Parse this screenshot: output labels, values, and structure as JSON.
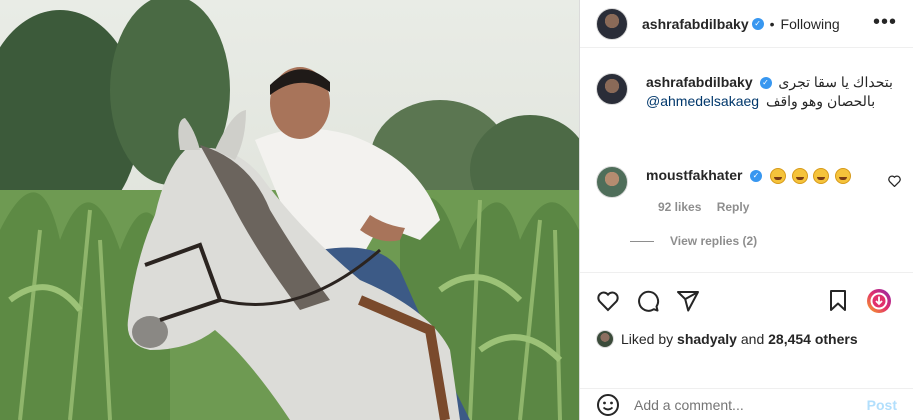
{
  "post": {
    "username": "ashrafabdilbaky",
    "follow_status": "Following",
    "separator": "•",
    "caption_line1": "بتحداك يا سقا تجرى",
    "caption_mention": "@ahmedelsakaeg",
    "caption_line2": "بالحصان وهو واقف"
  },
  "comments": [
    {
      "username": "moustfakhater",
      "emoji_count": 4,
      "likes": "92 likes",
      "reply_label": "Reply",
      "view_replies": "View replies (2)"
    }
  ],
  "likes": {
    "prefix": "Liked by",
    "user": "shadyaly",
    "conjunction": "and",
    "count": "28,454 others"
  },
  "add_comment": {
    "placeholder": "Add a comment...",
    "post_label": "Post"
  },
  "icons": {
    "more": "more-options-icon",
    "verified": "verified-badge-icon",
    "heart": "heart-icon",
    "comment": "comment-icon",
    "share": "share-icon",
    "save": "bookmark-icon",
    "emoji": "emoji-icon"
  },
  "colors": {
    "verified": "#3897f0",
    "link": "#00376b",
    "muted": "#8e8e8e",
    "post_disabled": "#b2dffc"
  }
}
